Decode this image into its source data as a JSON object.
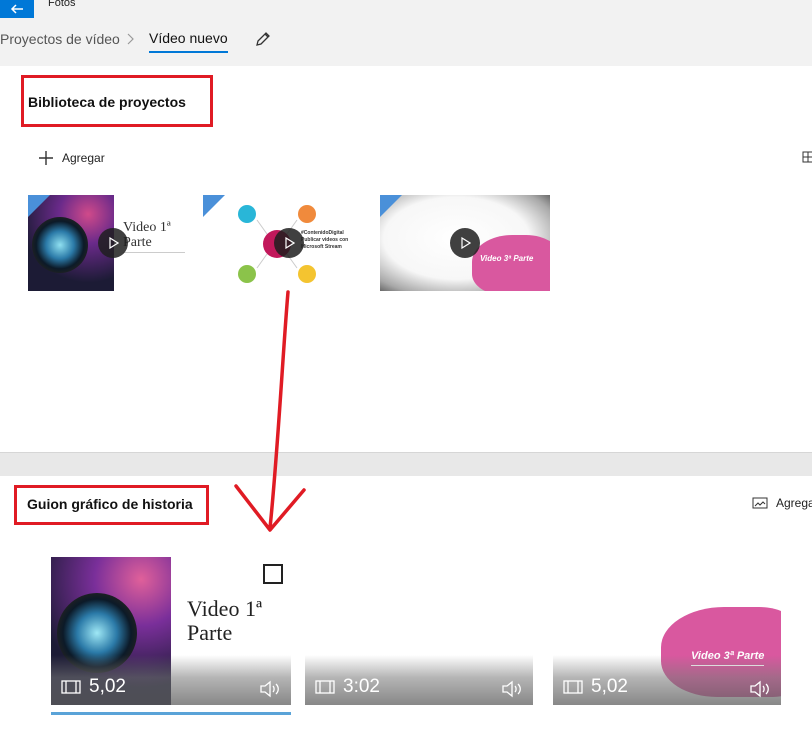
{
  "app": {
    "title": "Fotos",
    "back_icon": "back-arrow-icon"
  },
  "breadcrumb": {
    "parent": "Proyectos de vídeo",
    "current": "Vídeo nuevo"
  },
  "library": {
    "title": "Biblioteca de proyectos",
    "add_label": "Agregar",
    "clips": [
      {
        "label_line1": "Video 1ª",
        "label_line2": "Parte"
      },
      {
        "label_line1": "#ContenidoDigital",
        "label_line2": "Publicar videos con",
        "label_line3": "Microsoft Stream"
      },
      {
        "label_line1": "Video 3ª Parte"
      }
    ]
  },
  "storyboard": {
    "title": "Guion gráfico de historia",
    "add_label": "Agrega",
    "cards": [
      {
        "title_line1": "Video 1ª",
        "title_line2": "Parte",
        "duration": "5,02"
      },
      {
        "duration": "3:02"
      },
      {
        "title": "Video 3ª Parte",
        "duration": "5,02"
      }
    ]
  },
  "colors": {
    "accent": "#0078d7",
    "annotation": "#e01b24",
    "clip3_pink": "#d9589f"
  }
}
